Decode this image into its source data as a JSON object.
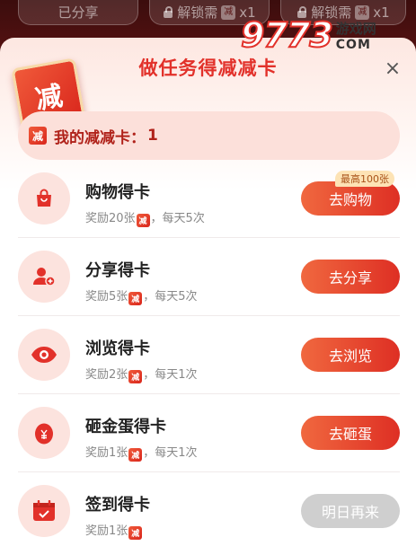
{
  "background": {
    "pill1": "已分享",
    "pill2": {
      "text": "解锁需",
      "badge": "减",
      "count": "x1"
    },
    "pill3": {
      "text": "解锁需",
      "badge": "减",
      "count": "x1"
    }
  },
  "header": {
    "card_char": "减",
    "title": "做任务得减减卡",
    "close": "×"
  },
  "watermark": {
    "digits": "9773",
    "cn": "游戏网",
    "com": "COM"
  },
  "my_cards": {
    "badge": "减",
    "label": "我的减减卡：",
    "count": "1"
  },
  "tasks": [
    {
      "name": "购物得卡",
      "reward_pre": "奖励20张",
      "reward_badge": "减",
      "reward_post": "，每天5次",
      "button": "去购物",
      "tag": "最高100张",
      "icon": "shopping-bag-icon"
    },
    {
      "name": "分享得卡",
      "reward_pre": "奖励5张",
      "reward_badge": "减",
      "reward_post": "，每天5次",
      "button": "去分享",
      "icon": "user-add-icon"
    },
    {
      "name": "浏览得卡",
      "reward_pre": "奖励2张",
      "reward_badge": "减",
      "reward_post": "，每天1次",
      "button": "去浏览",
      "icon": "eye-icon"
    },
    {
      "name": "砸金蛋得卡",
      "reward_pre": "奖励1张",
      "reward_badge": "减",
      "reward_post": "，每天1次",
      "button": "去砸蛋",
      "icon": "golden-egg-icon"
    },
    {
      "name": "签到得卡",
      "reward_pre": "奖励1张",
      "reward_badge": "减",
      "reward_post": "",
      "button": "明日再来",
      "icon": "calendar-check-icon"
    }
  ],
  "colors": {
    "accent": "#e2312a",
    "button_start": "#f0683f",
    "button_end": "#de2f24",
    "disabled": "#cfcfcf"
  }
}
